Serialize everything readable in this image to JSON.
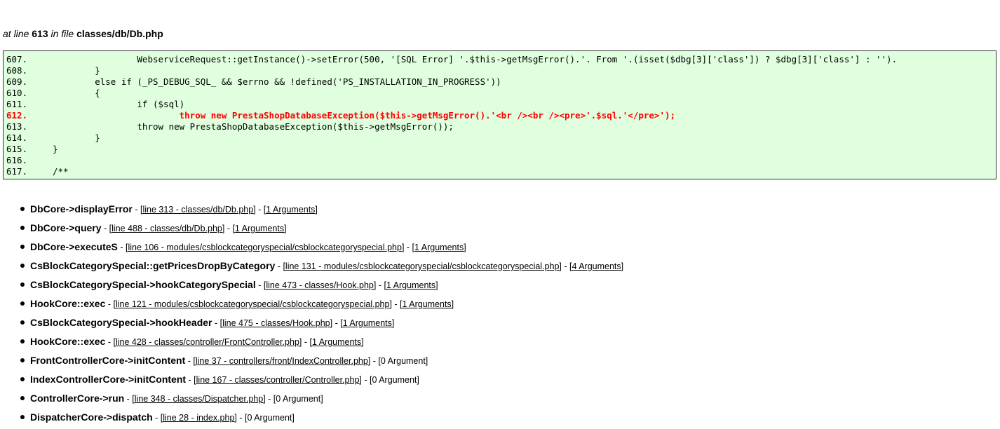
{
  "location": {
    "prefix": "at line",
    "line": "613",
    "middle": "in file",
    "file": "classes/db/Db.php"
  },
  "code_lines": [
    {
      "num": "607.",
      "code": "                WebserviceRequest::getInstance()->setError(500, '[SQL Error] '.$this->getMsgError().'. From '.(isset($dbg[3]['class']) ? $dbg[3]['class'] : '').",
      "highlight": false
    },
    {
      "num": "608.",
      "code": "        }",
      "highlight": false
    },
    {
      "num": "609.",
      "code": "        else if (_PS_DEBUG_SQL_ && $errno && !defined('PS_INSTALLATION_IN_PROGRESS'))",
      "highlight": false
    },
    {
      "num": "610.",
      "code": "        {",
      "highlight": false
    },
    {
      "num": "611.",
      "code": "                if ($sql)",
      "highlight": false
    },
    {
      "num": "612.",
      "code": "                        throw new PrestaShopDatabaseException($this->getMsgError().'<br /><br /><pre>'.$sql.'</pre>');",
      "highlight": true
    },
    {
      "num": "613.",
      "code": "                throw new PrestaShopDatabaseException($this->getMsgError());",
      "highlight": false
    },
    {
      "num": "614.",
      "code": "        }",
      "highlight": false
    },
    {
      "num": "615.",
      "code": "}",
      "highlight": false
    },
    {
      "num": "616.",
      "code": "",
      "highlight": false
    },
    {
      "num": "617.",
      "code": "/**",
      "highlight": false
    }
  ],
  "trace": [
    {
      "fn": "DbCore->displayError",
      "line_link": "[line 313 - classes/db/Db.php]",
      "args": "[1 Arguments]",
      "args_link": true
    },
    {
      "fn": "DbCore->query",
      "line_link": "[line 488 - classes/db/Db.php]",
      "args": "[1 Arguments]",
      "args_link": true
    },
    {
      "fn": "DbCore->executeS",
      "line_link": "[line 106 - modules/csblockcategoryspecial/csblockcategoryspecial.php]",
      "args": "[1 Arguments]",
      "args_link": true
    },
    {
      "fn": "CsBlockCategorySpecial::getPricesDropByCategory",
      "line_link": "[line 131 - modules/csblockcategoryspecial/csblockcategoryspecial.php]",
      "args": "[4 Arguments]",
      "args_link": true
    },
    {
      "fn": "CsBlockCategorySpecial->hookCategorySpecial",
      "line_link": "[line 473 - classes/Hook.php]",
      "args": "[1 Arguments]",
      "args_link": true
    },
    {
      "fn": "HookCore::exec",
      "line_link": "[line 121 - modules/csblockcategoryspecial/csblockcategoryspecial.php]",
      "args": "[1 Arguments]",
      "args_link": true
    },
    {
      "fn": "CsBlockCategorySpecial->hookHeader",
      "line_link": "[line 475 - classes/Hook.php]",
      "args": "[1 Arguments]",
      "args_link": true
    },
    {
      "fn": "HookCore::exec",
      "line_link": "[line 428 - classes/controller/FrontController.php]",
      "args": "[1 Arguments]",
      "args_link": true
    },
    {
      "fn": "FrontControllerCore->initContent",
      "line_link": "[line 37 - controllers/front/IndexController.php]",
      "args": "[0 Argument]",
      "args_link": false
    },
    {
      "fn": "IndexControllerCore->initContent",
      "line_link": "[line 167 - classes/controller/Controller.php]",
      "args": "[0 Argument]",
      "args_link": false
    },
    {
      "fn": "ControllerCore->run",
      "line_link": "[line 348 - classes/Dispatcher.php]",
      "args": "[0 Argument]",
      "args_link": false
    },
    {
      "fn": "DispatcherCore->dispatch",
      "line_link": "[line 28 - index.php]",
      "args": "[0 Argument]",
      "args_link": false
    }
  ],
  "separator": " - ",
  "colors": {
    "code_background": "#dfffdf",
    "code_border": "#333333",
    "highlight_line": "#ff0000"
  }
}
